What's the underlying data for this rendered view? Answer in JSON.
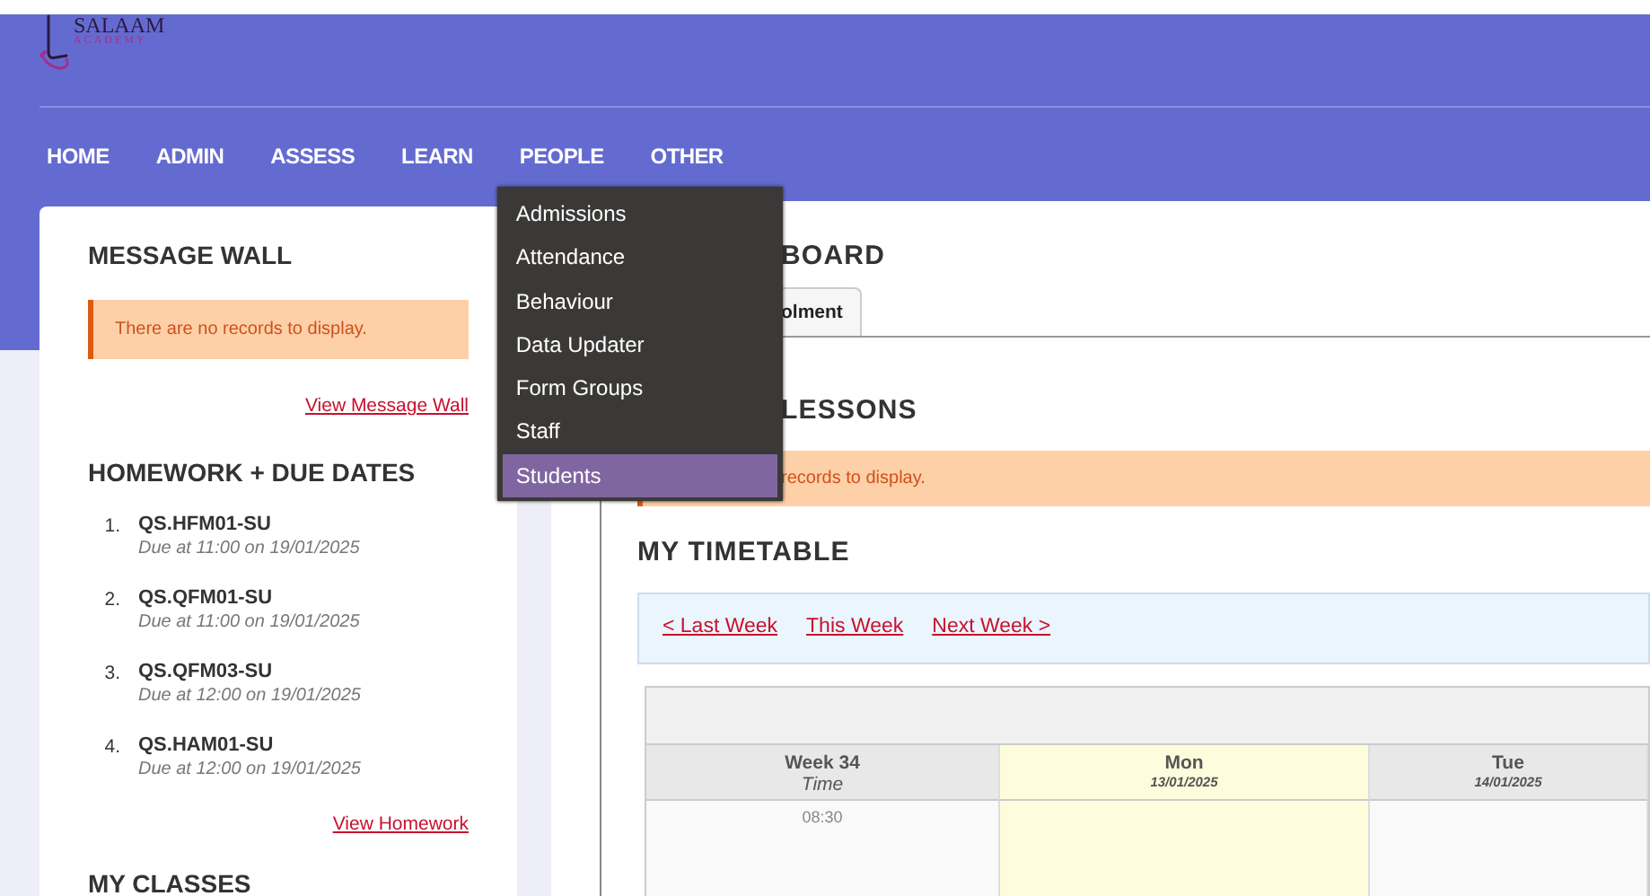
{
  "logo": {
    "name": "SALAAM",
    "tagline": "ACADEMY"
  },
  "nav": [
    {
      "label": "HOME"
    },
    {
      "label": "ADMIN"
    },
    {
      "label": "ASSESS"
    },
    {
      "label": "LEARN"
    },
    {
      "label": "PEOPLE",
      "expanded": true,
      "menu": [
        {
          "label": "Admissions",
          "selected": false
        },
        {
          "label": "Attendance",
          "selected": false
        },
        {
          "label": "Behaviour",
          "selected": false
        },
        {
          "label": "Data Updater",
          "selected": false
        },
        {
          "label": "Form Groups",
          "selected": false
        },
        {
          "label": "Staff",
          "selected": false
        },
        {
          "label": "Students",
          "selected": true
        }
      ]
    },
    {
      "label": "OTHER"
    }
  ],
  "message_wall": {
    "title": "MESSAGE WALL",
    "notice": "There are no records to display.",
    "link": "View Message Wall"
  },
  "homework": {
    "title": "HOMEWORK + DUE DATES",
    "items": [
      {
        "number": "1.",
        "code": "QS.HFM01-SU",
        "due": "Due at 11:00 on 19/01/2025"
      },
      {
        "number": "2.",
        "code": "QS.QFM01-SU",
        "due": "Due at 11:00 on 19/01/2025"
      },
      {
        "number": "3.",
        "code": "QS.QFM03-SU",
        "due": "Due at 12:00 on 19/01/2025"
      },
      {
        "number": "4.",
        "code": "QS.HAM01-SU",
        "due": "Due at 12:00 on 19/01/2025"
      }
    ],
    "link": "View Homework"
  },
  "my_classes": {
    "title": "MY CLASSES"
  },
  "dashboard": {
    "title": "BOARD",
    "tabs": [
      {
        "label": "olment",
        "selected": true
      }
    ]
  },
  "lessons": {
    "title": "LESSONS",
    "notice": "records to display."
  },
  "timetable": {
    "title": "MY TIMETABLE",
    "links": [
      "< Last Week",
      "This Week",
      "Next Week >"
    ],
    "week": "Week 34",
    "time_label": "Time",
    "days": [
      {
        "name": "Mon",
        "date": "13/01/2025",
        "highlighted": true
      },
      {
        "name": "Tue",
        "date": "14/01/2025",
        "highlighted": false
      }
    ],
    "times": [
      "08:30"
    ]
  }
}
